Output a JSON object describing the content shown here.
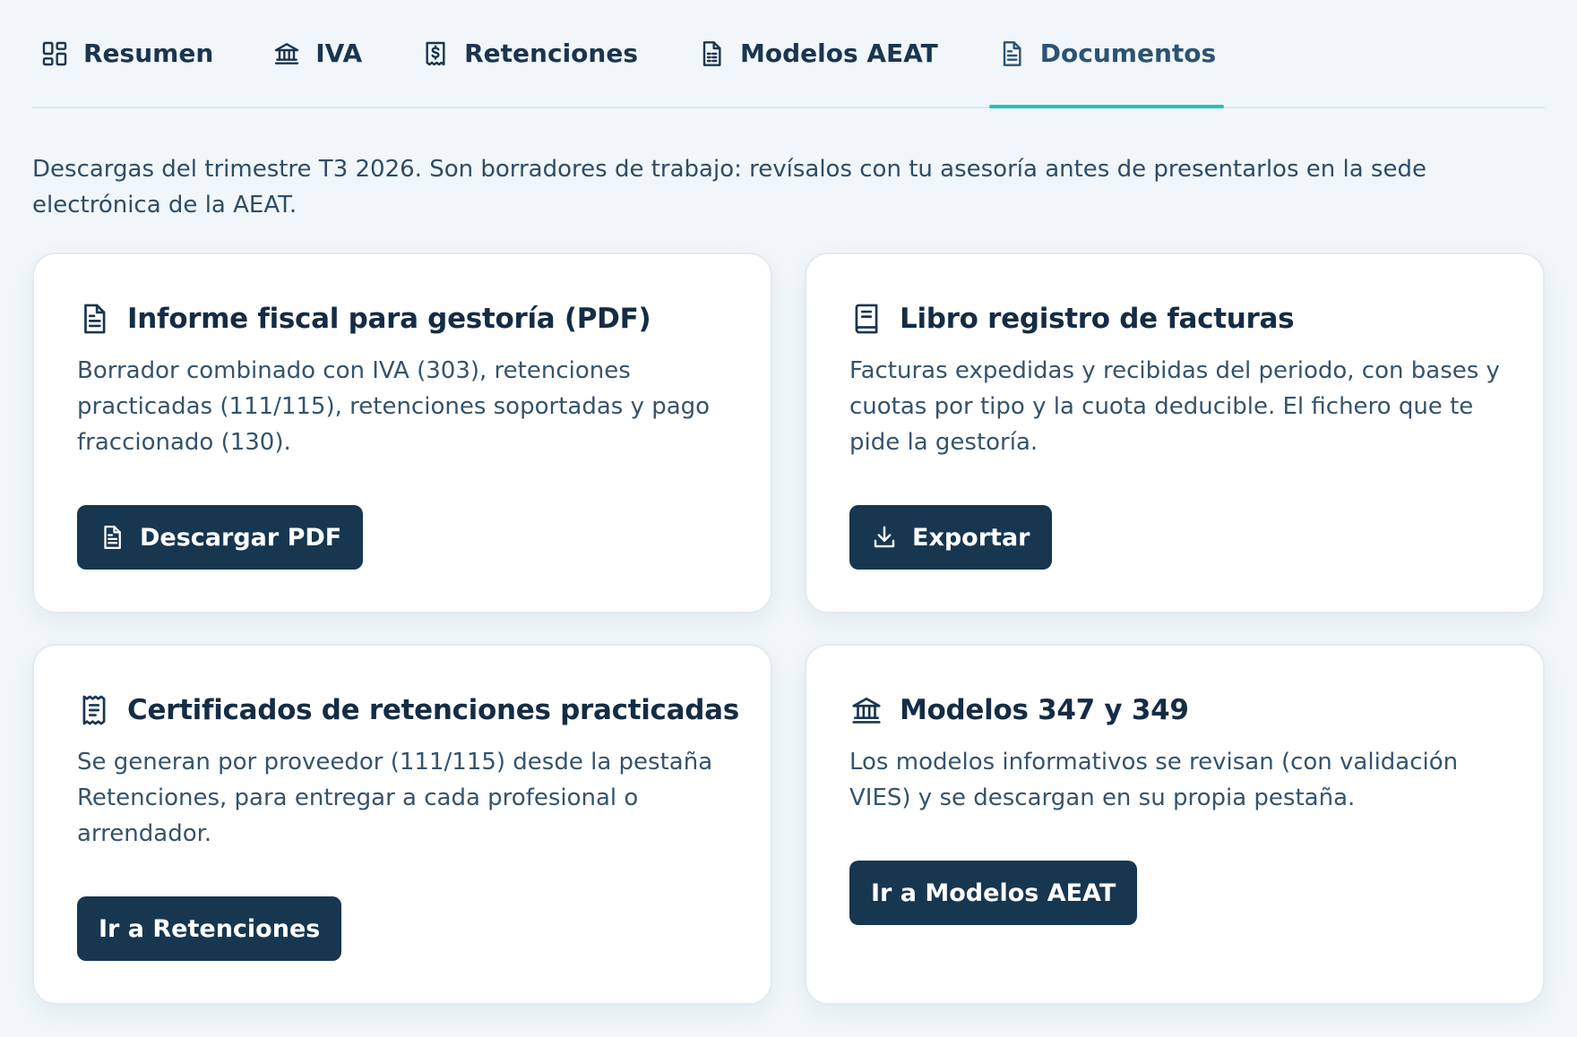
{
  "tabs": [
    {
      "label": "Resumen",
      "icon": "dashboard-icon",
      "active": false
    },
    {
      "label": "IVA",
      "icon": "bank-icon",
      "active": false
    },
    {
      "label": "Retenciones",
      "icon": "receipt-dollar-icon",
      "active": false
    },
    {
      "label": "Modelos AEAT",
      "icon": "spreadsheet-document-icon",
      "active": false
    },
    {
      "label": "Documentos",
      "icon": "document-icon",
      "active": true
    }
  ],
  "intro": "Descargas del trimestre T3 2026. Son borradores de trabajo: revísalos con tu asesoría antes de presentarlos en la sede electrónica de la AEAT.",
  "cards": [
    {
      "title": "Informe fiscal para gestoría (PDF)",
      "icon": "document-icon",
      "text": "Borrador combinado con IVA (303), retenciones practicadas (111/115), retenciones soportadas y pago fraccionado (130).",
      "button": "Descargar PDF",
      "button_icon": "document-icon"
    },
    {
      "title": "Libro registro de facturas",
      "icon": "book-icon",
      "text": "Facturas expedidas y recibidas del periodo, con bases y cuotas por tipo y la cuota deducible. El fichero que te pide la gestoría.",
      "button": "Exportar",
      "button_icon": "download-icon"
    },
    {
      "title": "Certificados de retenciones practicadas",
      "icon": "receipt-icon",
      "text": "Se generan por proveedor (111/115) desde la pestaña Retenciones, para entregar a cada profesional o arrendador.",
      "button": "Ir a Retenciones"
    },
    {
      "title": "Modelos 347 y 349",
      "icon": "bank-icon",
      "text": "Los modelos informativos se revisan (con validación VIES) y se descargan en su propia pestaña.",
      "button": "Ir a Modelos AEAT"
    }
  ],
  "colors": {
    "background": "#f0f6f9",
    "accent": "#21c4b3",
    "button": "#173650",
    "text": "#1b3550"
  }
}
